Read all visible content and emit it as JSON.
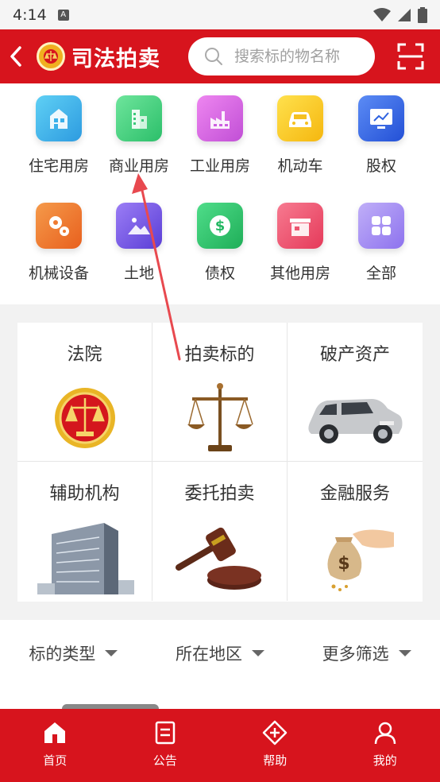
{
  "status_bar": {
    "time": "4:14",
    "notification_glyph": "A"
  },
  "header": {
    "title": "司法拍卖",
    "search_placeholder": "搜索标的物名称"
  },
  "categories": [
    {
      "label": "住宅用房",
      "icon": "residential-building-icon",
      "color": "#3bb0e8"
    },
    {
      "label": "商业用房",
      "icon": "commercial-building-icon",
      "color": "#3ccf7a"
    },
    {
      "label": "工业用房",
      "icon": "factory-icon",
      "color": "#d95ce0"
    },
    {
      "label": "机动车",
      "icon": "car-icon",
      "color": "#f7c21a"
    },
    {
      "label": "股权",
      "icon": "chart-screen-icon",
      "color": "#2f6ee5"
    },
    {
      "label": "机械设备",
      "icon": "gears-icon",
      "color": "#f07a2c"
    },
    {
      "label": "土地",
      "icon": "land-icon",
      "color": "#7a5ce8"
    },
    {
      "label": "债权",
      "icon": "dollar-icon",
      "color": "#2cc06a"
    },
    {
      "label": "其他用房",
      "icon": "shop-icon",
      "color": "#f0506a"
    },
    {
      "label": "全部",
      "icon": "grid-icon",
      "color": "#a08af0"
    }
  ],
  "features": [
    {
      "title": "法院",
      "icon": "court-emblem-icon"
    },
    {
      "title": "拍卖标的",
      "icon": "scales-icon"
    },
    {
      "title": "破产资产",
      "icon": "suv-car-icon"
    },
    {
      "title": "辅助机构",
      "icon": "office-building-icon"
    },
    {
      "title": "委托拍卖",
      "icon": "gavel-icon"
    },
    {
      "title": "金融服务",
      "icon": "money-bag-icon"
    }
  ],
  "filters": [
    {
      "label": "标的类型"
    },
    {
      "label": "所在地区"
    },
    {
      "label": "更多筛选"
    }
  ],
  "bottom_nav": [
    {
      "label": "首页",
      "icon": "home-icon",
      "active": true
    },
    {
      "label": "公告",
      "icon": "notice-icon"
    },
    {
      "label": "帮助",
      "icon": "help-icon"
    },
    {
      "label": "我的",
      "icon": "profile-icon"
    }
  ],
  "colors": {
    "brand_red": "#d7141d",
    "annotation_arrow": "#e8494f"
  }
}
